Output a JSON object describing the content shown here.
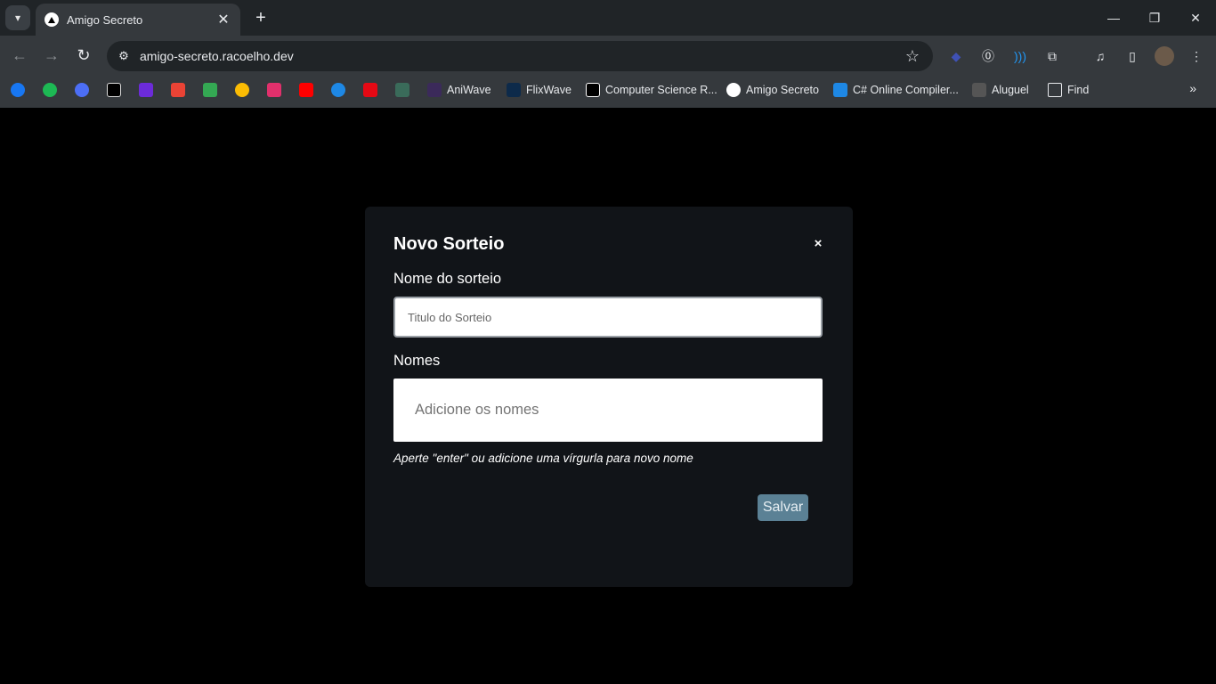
{
  "browser": {
    "tab": {
      "title": "Amigo Secreto",
      "close_glyph": "✕"
    },
    "new_tab_glyph": "+",
    "window_controls": {
      "minimize": "—",
      "restore": "❐",
      "close": "✕"
    },
    "url": "amigo-secreto.racoelho.dev",
    "bookmarks": [
      {
        "name": "facebook-icon",
        "color": "#1877f2"
      },
      {
        "name": "spotify-icon",
        "color": "#1db954"
      },
      {
        "name": "app-icon",
        "color": "#4c6ef5"
      },
      {
        "name": "x-icon",
        "color": "#000000"
      },
      {
        "name": "mail-icon",
        "color": "#6c2bd9"
      },
      {
        "name": "gmail-icon",
        "color": "#ea4335"
      },
      {
        "name": "drive-icon",
        "color": "#34a853"
      },
      {
        "name": "photos-icon",
        "color": "#fbbc04"
      },
      {
        "name": "instagram-icon",
        "color": "#e1306c"
      },
      {
        "name": "youtube-icon",
        "color": "#ff0000"
      },
      {
        "name": "play-icon",
        "color": "#1e88e5"
      },
      {
        "name": "netflix-icon",
        "color": "#e50914"
      },
      {
        "name": "tree-icon",
        "color": "#3a6b5a"
      }
    ],
    "bookmark_links": [
      {
        "label": "AniWave"
      },
      {
        "label": "FlixWave"
      },
      {
        "label": "Computer Science R..."
      },
      {
        "label": "Amigo Secreto"
      },
      {
        "label": "C# Online Compiler..."
      },
      {
        "label": "Aluguel"
      },
      {
        "label": "Find"
      }
    ],
    "bookmarks_more": "»"
  },
  "modal": {
    "title": "Novo Sorteio",
    "close_glyph": "×",
    "name_label": "Nome do sorteio",
    "name_placeholder": "Titulo do Sorteio",
    "names_label": "Nomes",
    "names_placeholder": "Adicione os nomes",
    "hint": "Aperte \"enter\" ou adicione uma vírgurla para novo nome",
    "save_label": "Salvar"
  },
  "colors": {
    "modal_bg": "#111418",
    "save_button": "#5b8195",
    "page_bg": "#000000"
  }
}
